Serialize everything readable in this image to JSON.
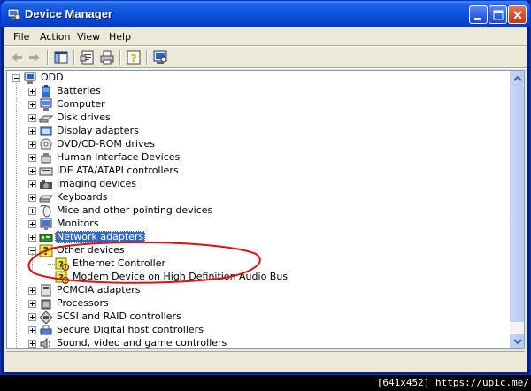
{
  "window": {
    "title": "Device Manager"
  },
  "menu": [
    "File",
    "Action",
    "View",
    "Help"
  ],
  "tree": {
    "root": "ODD",
    "categories": [
      {
        "label": "Batteries",
        "icon": "battery-icon"
      },
      {
        "label": "Computer",
        "icon": "computer-icon"
      },
      {
        "label": "Disk drives",
        "icon": "disk-drive-icon"
      },
      {
        "label": "Display adapters",
        "icon": "display-adapter-icon"
      },
      {
        "label": "DVD/CD-ROM drives",
        "icon": "dvd-drive-icon"
      },
      {
        "label": "Human Interface Devices",
        "icon": "hid-icon"
      },
      {
        "label": "IDE ATA/ATAPI controllers",
        "icon": "ide-controller-icon"
      },
      {
        "label": "Imaging devices",
        "icon": "imaging-device-icon"
      },
      {
        "label": "Keyboards",
        "icon": "keyboard-icon"
      },
      {
        "label": "Mice and other pointing devices",
        "icon": "mouse-icon"
      },
      {
        "label": "Monitors",
        "icon": "monitor-icon"
      },
      {
        "label": "Network adapters",
        "icon": "network-adapter-icon"
      },
      {
        "label": "Other devices",
        "icon": "unknown-device-icon"
      },
      {
        "label": "Ethernet Controller",
        "icon": "unknown-device-warning-icon"
      },
      {
        "label": "Modem Device on High Definition Audio Bus",
        "icon": "unknown-device-warning-icon"
      },
      {
        "label": "PCMCIA adapters",
        "icon": "pcmcia-icon"
      },
      {
        "label": "Processors",
        "icon": "processor-icon"
      },
      {
        "label": "SCSI and RAID controllers",
        "icon": "scsi-icon"
      },
      {
        "label": "Secure Digital host controllers",
        "icon": "sd-host-icon"
      },
      {
        "label": "Sound, video and game controllers",
        "icon": "sound-icon"
      }
    ]
  },
  "selected": "Network adapters",
  "watermark": "[641x452] https://upic.me/",
  "colors": {
    "selection": "#316ac5",
    "titlebar": "#0a53e0",
    "annotation": "#e01010"
  }
}
